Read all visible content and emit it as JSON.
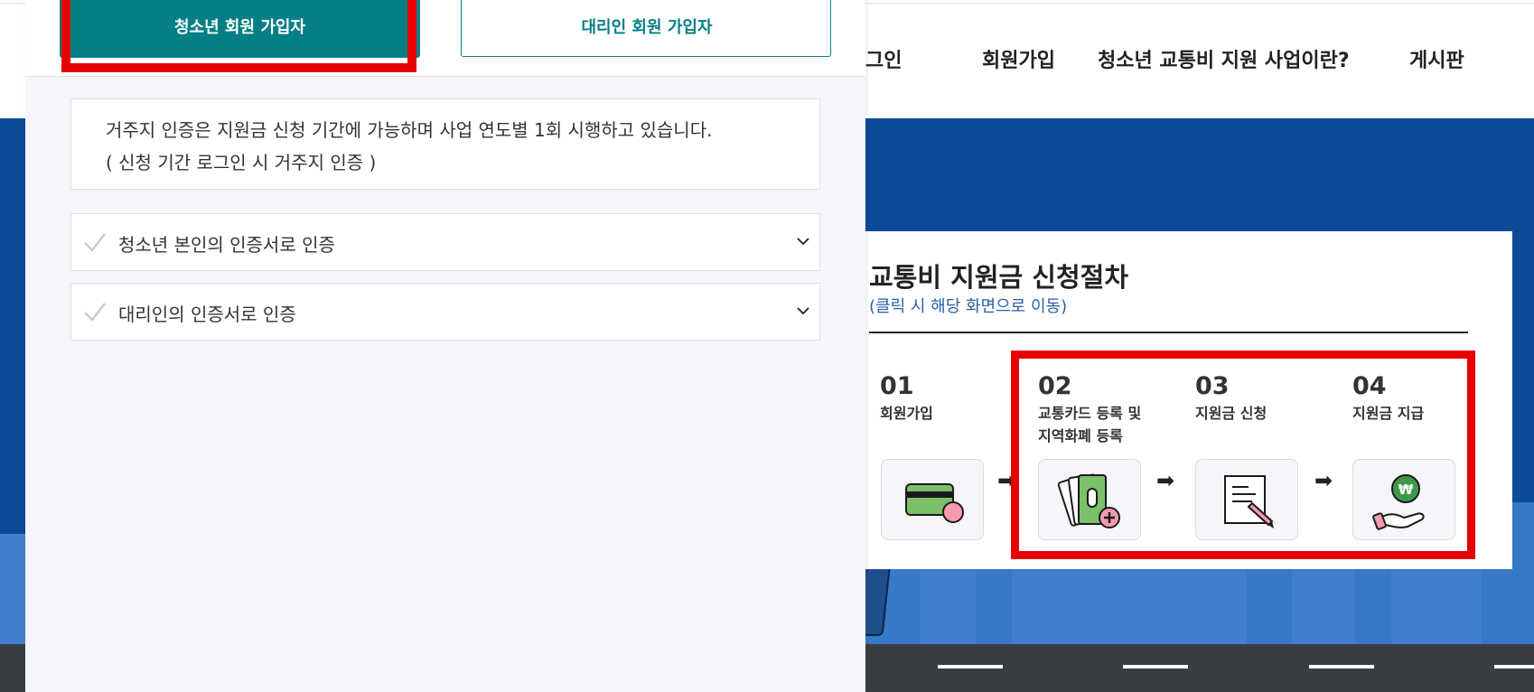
{
  "header": {
    "nav": [
      "그인",
      "회원가입",
      "청소년 교통비 지원 사업이란?",
      "게시판"
    ]
  },
  "steps": {
    "title": "교통비 지원금 신청절차",
    "subtitle": "(클릭 시 해당 화면으로 이동)",
    "items": [
      {
        "num": "01",
        "label_1": "회원가입",
        "label_2": "",
        "icon": "card-icon"
      },
      {
        "num": "02",
        "label_1": "교통카드 등록 및",
        "label_2": "지역화폐 등록",
        "icon": "money-add-icon"
      },
      {
        "num": "03",
        "label_1": "지원금 신청",
        "label_2": "",
        "icon": "document-pen-icon"
      },
      {
        "num": "04",
        "label_1": "지원금 지급",
        "label_2": "",
        "icon": "won-coin-hand-icon"
      }
    ],
    "arrow_glyph": "➡"
  },
  "modal": {
    "tabs": {
      "youth": "청소년 회원 가입자",
      "proxy": "대리인 회원 가입자"
    },
    "notice": {
      "line1": "거주지 인증은 지원금 신청 기간에 가능하며 사업 연도별 1회 시행하고 있습니다.",
      "line2": "( 신청 기간 로그인 시 거주지 인증 )"
    },
    "accordions": [
      {
        "label": "청소년 본인의 인증서로 인증"
      },
      {
        "label": "대리인의 인증서로 인증"
      }
    ]
  },
  "colors": {
    "teal": "#057f86",
    "hero_blue": "#0a4a97",
    "highlight_red": "#e60000"
  }
}
